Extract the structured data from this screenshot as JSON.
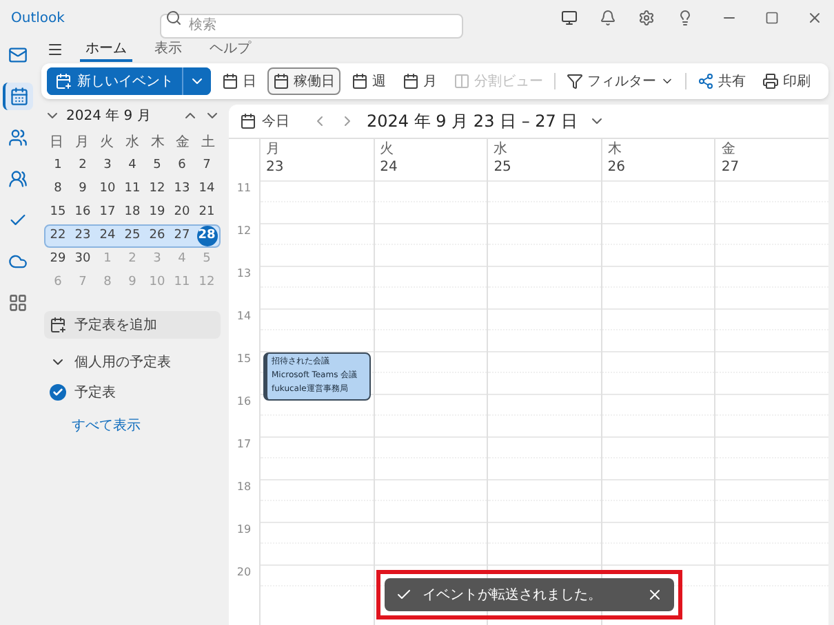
{
  "window": {
    "app_name": "Outlook"
  },
  "search": {
    "placeholder": "検索"
  },
  "nav_rail": [
    {
      "selected": false
    },
    {
      "selected": true
    },
    {
      "selected": false
    },
    {
      "selected": false
    },
    {
      "selected": false
    },
    {
      "selected": false
    },
    {
      "selected": false
    }
  ],
  "tabs": [
    {
      "label": "ホーム",
      "selected": true
    },
    {
      "label": "表示",
      "selected": false
    },
    {
      "label": "ヘルプ",
      "selected": false
    }
  ],
  "ribbon": {
    "new_event": "新しいイベント",
    "items": [
      {
        "kind": "view",
        "label": "日",
        "selected": false,
        "disabled": false
      },
      {
        "kind": "view",
        "label": "稼働日",
        "selected": true,
        "disabled": false
      },
      {
        "kind": "view",
        "label": "週",
        "selected": false,
        "disabled": false
      },
      {
        "kind": "view",
        "label": "月",
        "selected": false,
        "disabled": false
      },
      {
        "kind": "split",
        "label": "分割ビュー",
        "selected": false,
        "disabled": true
      },
      {
        "kind": "filter",
        "label": "フィルター",
        "selected": false,
        "disabled": false
      },
      {
        "kind": "share",
        "label": "共有",
        "selected": false,
        "disabled": false
      },
      {
        "kind": "print",
        "label": "印刷",
        "selected": false,
        "disabled": false
      }
    ]
  },
  "mini_calendar": {
    "title": "2024 年 9 月",
    "weekdays": [
      "日",
      "月",
      "火",
      "水",
      "木",
      "金",
      "土"
    ],
    "weeks": [
      {
        "selected": false,
        "days": [
          {
            "d": "1",
            "other_month": false,
            "today": false
          },
          {
            "d": "2",
            "other_month": false,
            "today": false
          },
          {
            "d": "3",
            "other_month": false,
            "today": false
          },
          {
            "d": "4",
            "other_month": false,
            "today": false
          },
          {
            "d": "5",
            "other_month": false,
            "today": false
          },
          {
            "d": "6",
            "other_month": false,
            "today": false
          },
          {
            "d": "7",
            "other_month": false,
            "today": false
          }
        ]
      },
      {
        "selected": false,
        "days": [
          {
            "d": "8",
            "other_month": false,
            "today": false
          },
          {
            "d": "9",
            "other_month": false,
            "today": false
          },
          {
            "d": "10",
            "other_month": false,
            "today": false
          },
          {
            "d": "11",
            "other_month": false,
            "today": false
          },
          {
            "d": "12",
            "other_month": false,
            "today": false
          },
          {
            "d": "13",
            "other_month": false,
            "today": false
          },
          {
            "d": "14",
            "other_month": false,
            "today": false
          }
        ]
      },
      {
        "selected": false,
        "days": [
          {
            "d": "15",
            "other_month": false,
            "today": false
          },
          {
            "d": "16",
            "other_month": false,
            "today": false
          },
          {
            "d": "17",
            "other_month": false,
            "today": false
          },
          {
            "d": "18",
            "other_month": false,
            "today": false
          },
          {
            "d": "19",
            "other_month": false,
            "today": false
          },
          {
            "d": "20",
            "other_month": false,
            "today": false
          },
          {
            "d": "21",
            "other_month": false,
            "today": false
          }
        ]
      },
      {
        "selected": true,
        "days": [
          {
            "d": "22",
            "other_month": false,
            "today": false
          },
          {
            "d": "23",
            "other_month": false,
            "today": false
          },
          {
            "d": "24",
            "other_month": false,
            "today": false
          },
          {
            "d": "25",
            "other_month": false,
            "today": false
          },
          {
            "d": "26",
            "other_month": false,
            "today": false
          },
          {
            "d": "27",
            "other_month": false,
            "today": false
          },
          {
            "d": "28",
            "other_month": false,
            "today": true
          }
        ]
      },
      {
        "selected": false,
        "days": [
          {
            "d": "29",
            "other_month": false,
            "today": false
          },
          {
            "d": "30",
            "other_month": false,
            "today": false
          },
          {
            "d": "1",
            "other_month": true,
            "today": false
          },
          {
            "d": "2",
            "other_month": true,
            "today": false
          },
          {
            "d": "3",
            "other_month": true,
            "today": false
          },
          {
            "d": "4",
            "other_month": true,
            "today": false
          },
          {
            "d": "5",
            "other_month": true,
            "today": false
          }
        ]
      },
      {
        "selected": false,
        "days": [
          {
            "d": "6",
            "other_month": true,
            "today": false
          },
          {
            "d": "7",
            "other_month": true,
            "today": false
          },
          {
            "d": "8",
            "other_month": true,
            "today": false
          },
          {
            "d": "9",
            "other_month": true,
            "today": false
          },
          {
            "d": "10",
            "other_month": true,
            "today": false
          },
          {
            "d": "11",
            "other_month": true,
            "today": false
          },
          {
            "d": "12",
            "other_month": true,
            "today": false
          }
        ]
      }
    ]
  },
  "calendars_pane": {
    "add": "予定表を追加",
    "group": {
      "label": "個人用の予定表",
      "expanded": true
    },
    "calendars": [
      {
        "label": "予定表",
        "checked": true
      }
    ],
    "show_all": "すべて表示"
  },
  "calendar_header": {
    "today": "今日",
    "range": "2024 年 9 月 23 日 – 27 日"
  },
  "days": [
    {
      "weekday": "月",
      "date": "23",
      "events": [
        {
          "lines": [
            "招待された会議",
            "Microsoft Teams 会議",
            "fukucale運営事務局"
          ]
        }
      ]
    },
    {
      "weekday": "火",
      "date": "24"
    },
    {
      "weekday": "水",
      "date": "25"
    },
    {
      "weekday": "木",
      "date": "26"
    },
    {
      "weekday": "金",
      "date": "27"
    }
  ],
  "hours": [
    "11",
    "12",
    "13",
    "14",
    "15",
    "16",
    "17",
    "18",
    "19",
    "20"
  ],
  "toast": {
    "message": "イベントが転送されました。",
    "highlighted": true
  }
}
